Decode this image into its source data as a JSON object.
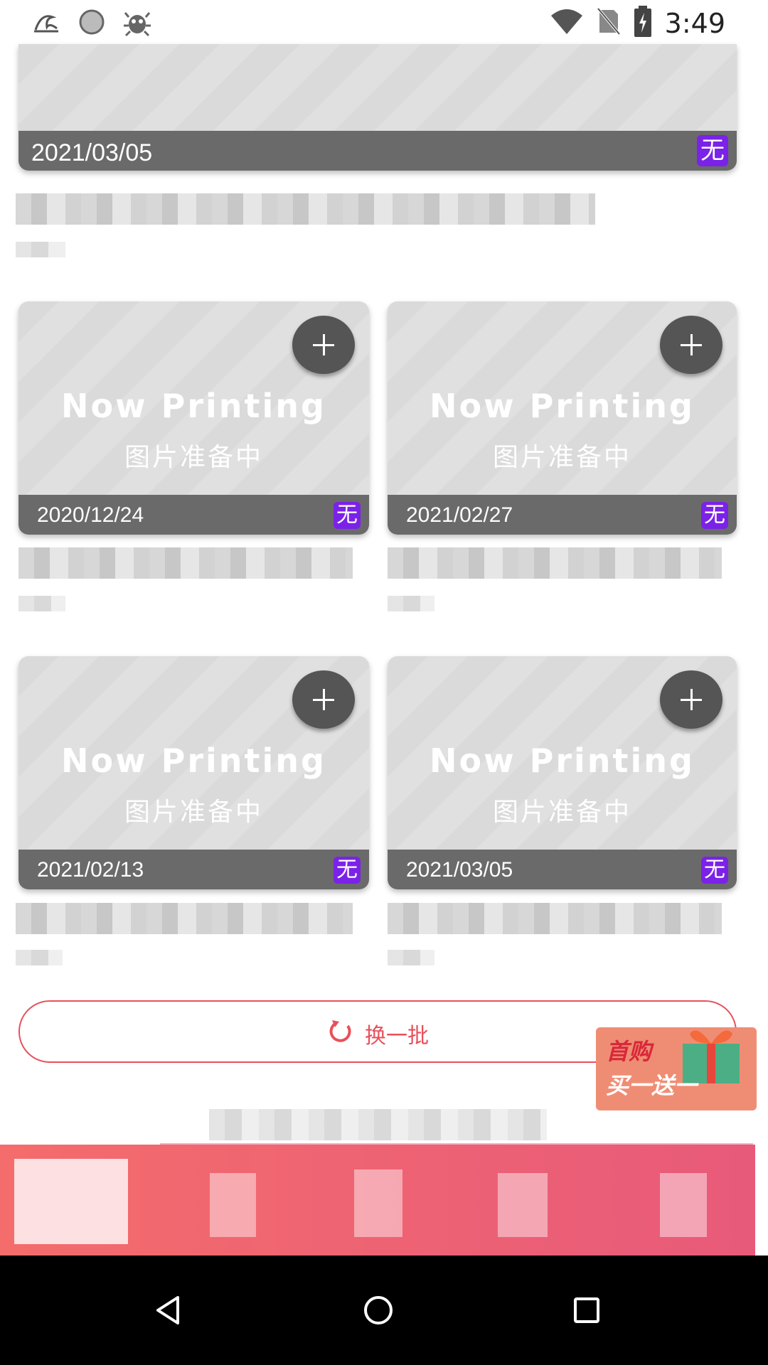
{
  "status_bar": {
    "time": "3:49",
    "left_icons": [
      "app-notification-icon",
      "circle-status-icon",
      "bug-icon"
    ],
    "right_icons": [
      "wifi-icon",
      "no-sim-icon",
      "battery-charging-icon"
    ]
  },
  "top_card": {
    "date": "2021/03/05",
    "badge": "无"
  },
  "grid_cards": [
    {
      "title": "Now Printing",
      "subtitle": "图片准备中",
      "date": "2020/12/24",
      "badge": "无"
    },
    {
      "title": "Now Printing",
      "subtitle": "图片准备中",
      "date": "2021/02/27",
      "badge": "无"
    },
    {
      "title": "Now Printing",
      "subtitle": "图片准备中",
      "date": "2021/02/13",
      "badge": "无"
    },
    {
      "title": "Now Printing",
      "subtitle": "图片准备中",
      "date": "2021/03/05",
      "badge": "无"
    }
  ],
  "refresh_button": {
    "label": "换一批",
    "icon": "refresh-icon"
  },
  "promo": {
    "line1": "首购",
    "line2": "买一送一",
    "icon": "gift-icon"
  },
  "nav_bar": {
    "items": [
      "back-icon",
      "home-icon",
      "recents-icon"
    ]
  },
  "colors": {
    "accent": "#e8505b",
    "badge": "#7b22e8",
    "date_bar": "#6a6a6a",
    "add_button": "#555555"
  }
}
